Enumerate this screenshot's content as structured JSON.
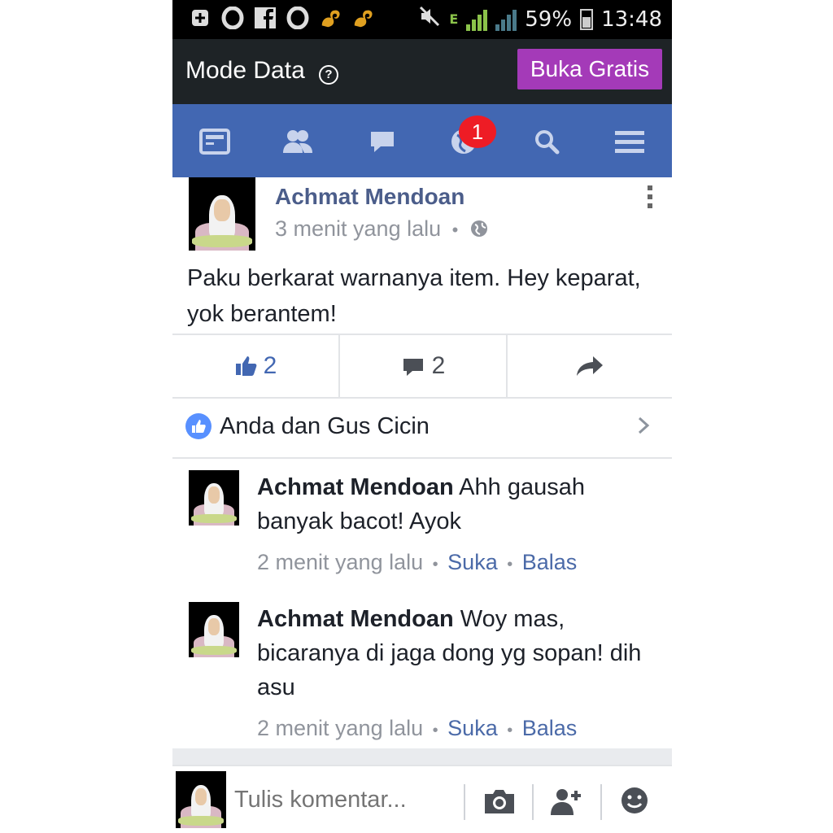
{
  "status_bar": {
    "battery": "59%",
    "time": "13:48",
    "network": "E",
    "left_icons": [
      "plus-box-icon",
      "opera-icon",
      "facebook-icon",
      "opera-icon",
      "uc-browser-icon",
      "uc-browser-icon"
    ]
  },
  "mode_bar": {
    "title": "Mode Data",
    "help": "?",
    "button": "Buka Gratis"
  },
  "nav": {
    "notification_count": "1",
    "icons": [
      "news-feed-icon",
      "friends-icon",
      "messages-icon",
      "globe-icon",
      "search-icon",
      "menu-icon"
    ]
  },
  "post": {
    "author": "Achmat Mendoan",
    "time": "3 menit yang lalu",
    "separator": "•",
    "text": "Paku berkarat warnanya item. Hey keparat, yok berantem!",
    "like_count": "2",
    "comment_count": "2"
  },
  "likes": {
    "text": "Anda dan Gus Cicin"
  },
  "comments": [
    {
      "author": "Achmat Mendoan",
      "text": "Ahh gausah banyak bacot! Ayok",
      "time": "2 menit yang lalu",
      "like": "Suka",
      "reply": "Balas",
      "sep": "•"
    },
    {
      "author": "Achmat Mendoan",
      "text": "Woy mas, bicaranya di jaga dong yg sopan! dih asu",
      "time": "2 menit yang lalu",
      "like": "Suka",
      "reply": "Balas",
      "sep": "•"
    }
  ],
  "composer": {
    "placeholder": "Tulis komentar..."
  },
  "colors": {
    "fb_blue": "#4267b2",
    "buka_purple": "#a43ab8",
    "badge_red": "#ee1c25",
    "link_blue": "#4b6aa8"
  }
}
